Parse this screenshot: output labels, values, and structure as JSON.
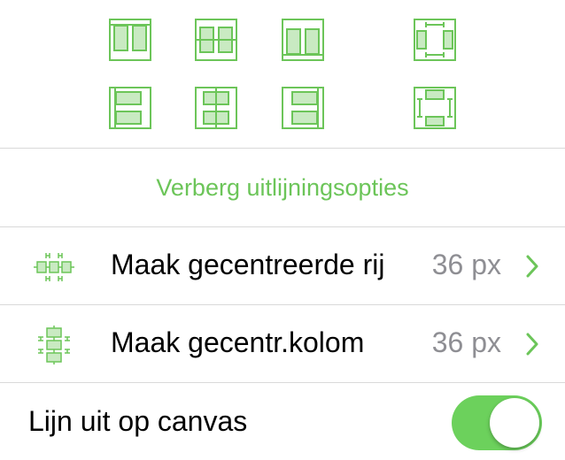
{
  "alignment_buttons": [
    {
      "name": "align-top-columns-icon"
    },
    {
      "name": "align-vertical-center-columns-icon"
    },
    {
      "name": "align-bottom-columns-icon"
    },
    {
      "name": "distribute-horizontal-icon"
    },
    {
      "name": "align-left-rows-icon"
    },
    {
      "name": "align-horizontal-center-rows-icon"
    },
    {
      "name": "align-right-rows-icon"
    },
    {
      "name": "distribute-vertical-icon"
    }
  ],
  "hide_options_label": "Verberg uitlijningsopties",
  "rows": [
    {
      "label": "Maak gecentreerde rij",
      "value": "36 px",
      "icon": "centered-row-icon"
    },
    {
      "label": "Maak gecentr.kolom",
      "value": "36 px",
      "icon": "centered-column-icon"
    }
  ],
  "canvas_toggle": {
    "label": "Lijn uit op canvas",
    "on": true
  },
  "colors": {
    "accent": "#6cc559",
    "switch_on": "#6cd15c",
    "secondary_text": "#8e8e93"
  }
}
